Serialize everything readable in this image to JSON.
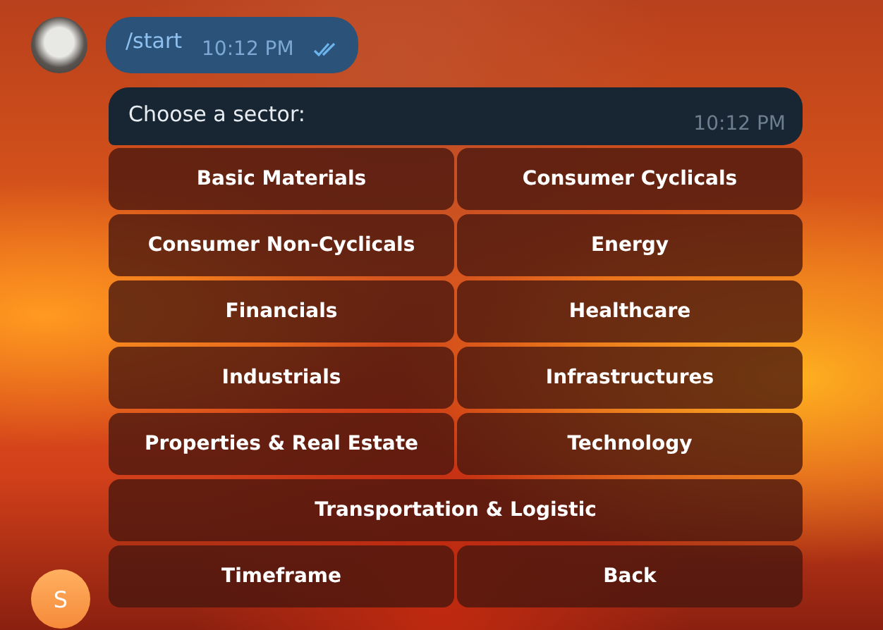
{
  "outgoing": {
    "text": "/start",
    "time": "10:12 PM",
    "read": true
  },
  "bot_message": {
    "text": "Choose a sector:",
    "time": "10:12 PM"
  },
  "keyboard": [
    [
      "Basic Materials",
      "Consumer Cyclicals"
    ],
    [
      "Consumer Non-Cyclicals",
      "Energy"
    ],
    [
      "Financials",
      "Healthcare"
    ],
    [
      "Industrials",
      "Infrastructures"
    ],
    [
      "Properties & Real Estate",
      "Technology"
    ],
    [
      "Transportation & Logistic"
    ],
    [
      "Timeframe",
      "Back"
    ]
  ],
  "bot_avatar": {
    "letter": "S"
  }
}
